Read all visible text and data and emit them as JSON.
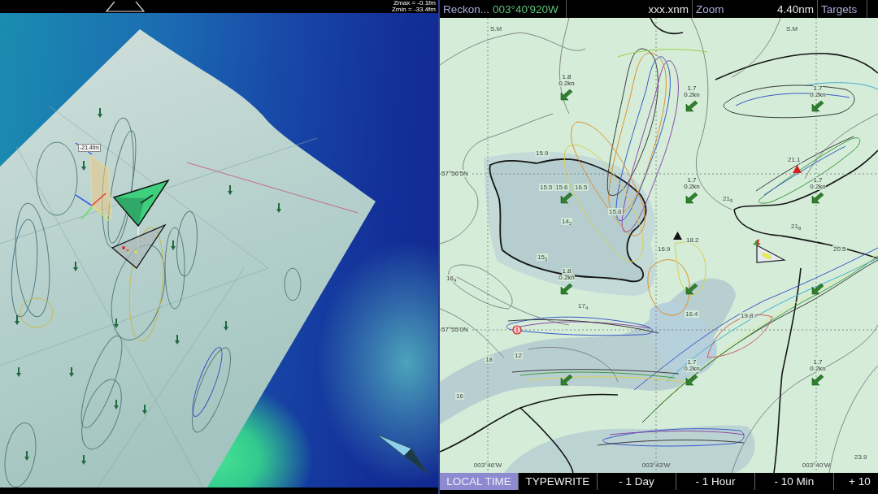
{
  "view_3d": {
    "zmax": "Zmax = -0.1fm",
    "zmin": "Zmin = -33.4fm",
    "depth_tag": "-21.4fm"
  },
  "chart_header": {
    "cells": [
      {
        "items": [
          {
            "kind": "label",
            "text": "Reckon..."
          },
          {
            "kind": "value",
            "text": "003°40'920W"
          }
        ]
      },
      {
        "items": [
          {
            "kind": "reading",
            "text": "xxx.xnm"
          }
        ]
      },
      {
        "items": [
          {
            "kind": "label",
            "text": "Zoom"
          },
          {
            "kind": "reading",
            "text": "4.40nm"
          }
        ]
      },
      {
        "items": [
          {
            "kind": "label",
            "text": "Targets"
          }
        ]
      }
    ]
  },
  "chart": {
    "area_marks": [
      "S.M",
      "S.M"
    ],
    "latitudes": [
      "57°56'5N",
      "57°55'0N"
    ],
    "longitudes": [
      "003°46'W",
      "003°43'W",
      "003°40'W"
    ],
    "soundings": [
      "15.9",
      "15.5",
      "15.6",
      "16.5",
      "15.8",
      "14$_{2}$",
      "15$_{3}$",
      "16.9",
      "18.2",
      "17$_{4}$",
      "16.4",
      "19.8",
      "21.1",
      "21$_{9}$",
      "21$_{8}$",
      "20.5",
      "12",
      "18",
      "16",
      "23.9",
      "16$_{4}$"
    ],
    "currents": [
      {
        "rate": "1.8",
        "speed": "0.2kn"
      },
      {
        "rate": "1.7",
        "speed": "0.2kn"
      },
      {
        "rate": "1.7",
        "speed": "0.2kn"
      },
      {
        "rate": "1.7",
        "speed": "0.2kn"
      },
      {
        "rate": "1.7",
        "speed": "0.2kn"
      },
      {
        "rate": "1.8",
        "speed": "0.2kn"
      },
      {
        "rate": "1.7",
        "speed": "0.2kn"
      },
      {
        "rate": "1.7",
        "speed": "0.2kn"
      }
    ],
    "targets": [
      {
        "color": "#111111"
      },
      {
        "color": "#d42020"
      }
    ]
  },
  "time_bar": {
    "buttons": [
      {
        "label": "LOCAL TIME",
        "selected": true
      },
      {
        "label": "TYPEWRITE",
        "selected": false
      },
      {
        "label": "- 1 Day",
        "selected": false
      },
      {
        "label": "- 1 Hour",
        "selected": false
      },
      {
        "label": "- 10 Min",
        "selected": false
      },
      {
        "label": "+ 10",
        "selected": false
      }
    ]
  }
}
